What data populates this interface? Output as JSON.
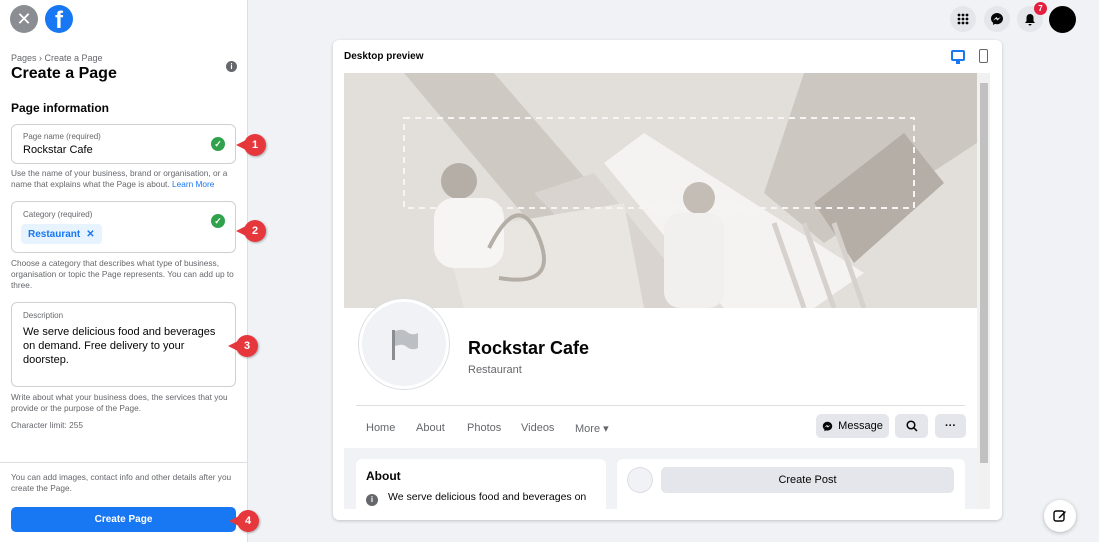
{
  "colors": {
    "brand": "#1877f2",
    "success": "#31a24c",
    "callout": "#e5373c",
    "badge": "#e41e3f"
  },
  "panel": {
    "breadcrumb": "Pages › Create a Page",
    "title": "Create a Page",
    "section": "Page information",
    "page_name": {
      "label": "Page name (required)",
      "value": "Rockstar Cafe"
    },
    "page_name_help": "Use the name of your business, brand or organisation, or a name that explains what the Page is about.",
    "learn_more": "Learn More",
    "category": {
      "label": "Category (required)",
      "chip": "Restaurant",
      "chip_remove": "✕"
    },
    "category_help": "Choose a category that describes what type of business, organisation or topic the Page represents. You can add up to three.",
    "description": {
      "label": "Description",
      "value": "We serve delicious food and beverages on demand. Free delivery to your doorstep."
    },
    "description_help": "Write about what your business does, the services that you provide or the purpose of the Page.",
    "char_limit": "Character limit: 255",
    "bottom_help": "You can add images, contact info and other details after you create the Page.",
    "create_button": "Create Page"
  },
  "callouts": [
    "1",
    "2",
    "3",
    "4"
  ],
  "header": {
    "notif_count": "7"
  },
  "preview": {
    "label": "Desktop preview",
    "page_name": "Rockstar Cafe",
    "category": "Restaurant",
    "tabs": [
      "Home",
      "About",
      "Photos",
      "Videos",
      "More ▾"
    ],
    "message_button": "Message",
    "more_button": "···",
    "about_title": "About",
    "about_desc": "We serve delicious food and beverages on",
    "create_post": "Create Post"
  },
  "icons": {
    "close": "✕",
    "logo": "f",
    "info": "i",
    "check": "✓",
    "grid": "⋮⋮⋮",
    "messenger": "messenger-icon",
    "bell": "bell-icon",
    "search": "search-icon",
    "compose": "compose-icon"
  }
}
